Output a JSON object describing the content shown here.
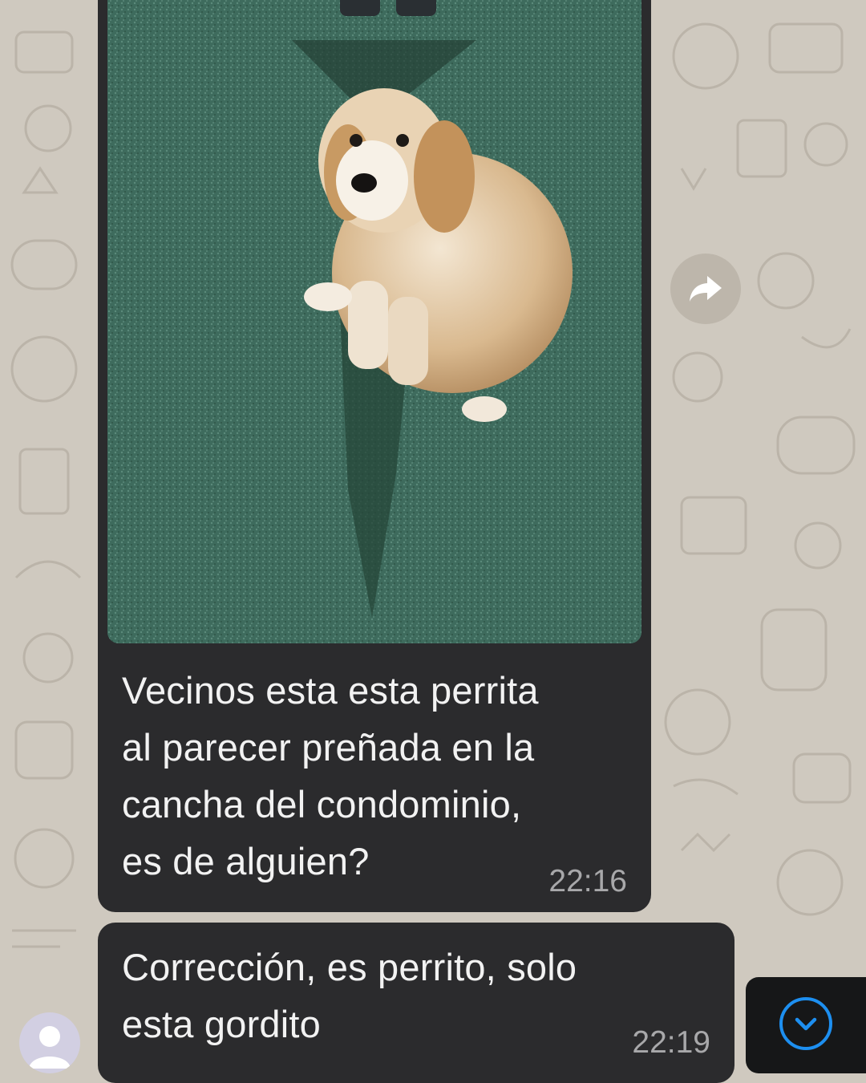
{
  "messages": [
    {
      "text_lines": [
        "Vecinos esta esta perrita",
        "al parecer preñada en la",
        "cancha del condominio,",
        "es de alguien?"
      ],
      "time": "22:16",
      "has_photo": true
    },
    {
      "text_lines": [
        "Corrección, es perrito, solo",
        "esta gordito"
      ],
      "time": "22:19"
    }
  ],
  "icons": {
    "forward": "forward-arrow-icon",
    "scroll_down": "chevron-down-icon",
    "avatar": "person-icon"
  },
  "colors": {
    "wallpaper": "#cfc9bf",
    "bubble": "#2b2b2d",
    "text": "#f2f2f2",
    "time": "#a8a8aa",
    "accent": "#1d8ff0"
  }
}
